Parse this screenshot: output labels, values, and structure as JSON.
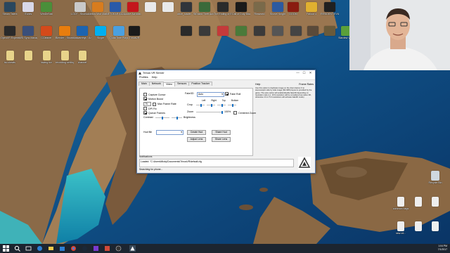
{
  "desktop": {
    "icons": [
      {
        "label": "Steam Talent",
        "color": "#2a475e"
      },
      {
        "label": "iTunes",
        "color": "#d8d8e8"
      },
      {
        "label": "WinDirStat",
        "color": "#4a8f3a"
      },
      {
        "label": "LOOT - Shortcut",
        "color": "#c9c9c9"
      },
      {
        "label": "Nexus Mod Manager",
        "color": "#d87c1e"
      },
      {
        "label": "NETGEAR A6210 Genie",
        "color": "#2a5aa8"
      },
      {
        "label": "Adobe Acrobat...",
        "color": "#c4161c"
      },
      {
        "label": "",
        "color": "#e9e9e9"
      },
      {
        "label": "",
        "color": "#e9e9e9"
      },
      {
        "label": "obce_loader - Shortcut",
        "color": "#30353b"
      },
      {
        "label": "Grand Theft Auto V",
        "color": "#3a6a3a"
      },
      {
        "label": "The Ending of Eternal Tr...",
        "color": "#2b2b2b"
      },
      {
        "label": "Call of Duty Black Ops III",
        "color": "#1a1a1a"
      },
      {
        "label": "Rimworld",
        "color": "#7a6a4a"
      },
      {
        "label": "Shovel Knight",
        "color": "#2c5aa0"
      },
      {
        "label": "DOOM",
        "color": "#8a1c10"
      },
      {
        "label": "Fallout 4",
        "color": "#e0b030"
      },
      {
        "label": "RESIDENT EVIL 7 biohaz...",
        "color": "#202020"
      },
      {
        "label": "OpenVR Experience",
        "color": "#2a2a2a"
      },
      {
        "label": "MSI Sync Manager",
        "color": "#3a4f7a"
      },
      {
        "label": "CCleaner",
        "color": "#d44a1a"
      },
      {
        "label": "Blender - Shortcut",
        "color": "#e87d0d"
      },
      {
        "label": "Malwarebyt... Anti-Malware",
        "color": "#1c64b0"
      },
      {
        "label": "Skype",
        "color": "#00aff0"
      },
      {
        "label": "QuickTime Player",
        "color": "#4aa0e0"
      },
      {
        "label": "TrinusVR",
        "color": "#1a1a1a"
      },
      {
        "label": "",
        "color": "#2a2a2a"
      },
      {
        "label": "",
        "color": "#3a3a3a"
      },
      {
        "label": "",
        "color": "#c43a3a"
      },
      {
        "label": "",
        "color": "#4a7a3a"
      },
      {
        "label": "",
        "color": "#3a3a3a"
      },
      {
        "label": "",
        "color": "#555"
      },
      {
        "label": "",
        "color": "#444"
      },
      {
        "label": "",
        "color": "#5a4a3a"
      },
      {
        "label": "",
        "color": "#6a5a3a"
      },
      {
        "label": "Stardew Valley",
        "color": "#5aa03a"
      },
      {
        "label": "isc cheats",
        "color": "#e8d48a"
      },
      {
        "label": "",
        "color": "#e8d48a"
      },
      {
        "label": "having fun",
        "color": "#e8d48a"
      },
      {
        "label": "recording settings",
        "color": "#e8d48a"
      },
      {
        "label": "channel",
        "color": "#e8d48a"
      },
      {
        "label": "Recycle Bin",
        "color": "#cfd8e0"
      },
      {
        "label": "common hags",
        "color": "#eeeeee"
      },
      {
        "label": "",
        "color": "#eeeeee"
      },
      {
        "label": "",
        "color": "#eeeeee"
      },
      {
        "label": "new rel...",
        "color": "#eeeeee"
      },
      {
        "label": "",
        "color": "#eeeeee"
      },
      {
        "label": "",
        "color": "#eeeeee"
      }
    ]
  },
  "window": {
    "title": "Trinus VR Server",
    "controls": [
      "—",
      "☐",
      "✕"
    ],
    "menu": [
      "Profiles",
      "Help"
    ],
    "tabs": [
      "Main",
      "Network",
      "Video",
      "Sensors",
      "Position Tracker"
    ],
    "active_tab": "Video",
    "video": {
      "capture_cursor": "Capture Cursor",
      "motion_boost": "Motion Boost",
      "max_frame_rate_value": "75",
      "max_frame_rate_label": "Max Frame Rate",
      "dpi_fix": "DPI Fix",
      "queue_frames": "Queue Frames",
      "contrast": "Contrast",
      "brightness": "Brightness",
      "fake3d_label": "Fake3D",
      "fake3d_value": "Auto",
      "fake_roll": "Fake Roll",
      "crop": "Crop",
      "crop_cols": [
        "Left",
        "Right",
        "Top",
        "Bottom"
      ],
      "zoom": "Zoom",
      "zoom_value": "100%",
      "centered_zoom": "Centered Zoom",
      "hud_label": "Hud file",
      "hud_value": "",
      "create_hud": "Create Hud",
      "share_hud": "Share Hud",
      "adjust_lens": "Adjust Lens",
      "share_lens": "Share Lens"
    },
    "help_pane": {
      "title": "Help",
      "frame_rates": "Frame Rates",
      "text": "Use this option to duplicate image on the client device if no stereoscopic side by side image (SD-SBS) layout is provided by the game. The auto option will enable/disable fake3D depending on resolution ratio (i.e. 16:9 resolution will be considered as native 3D, otherwise 4:3 or 5:3 resolutions will activate fake3D mode)"
    },
    "notifications_label": "Notifications",
    "notification_text": "Loaded: \"C:\\Users\\Micky\\Documents\\TrinusVR\\default.cfg",
    "status": "Searching for phone..."
  },
  "taskbar": {
    "time": "1:04 PM",
    "date": "7/1/2017"
  }
}
